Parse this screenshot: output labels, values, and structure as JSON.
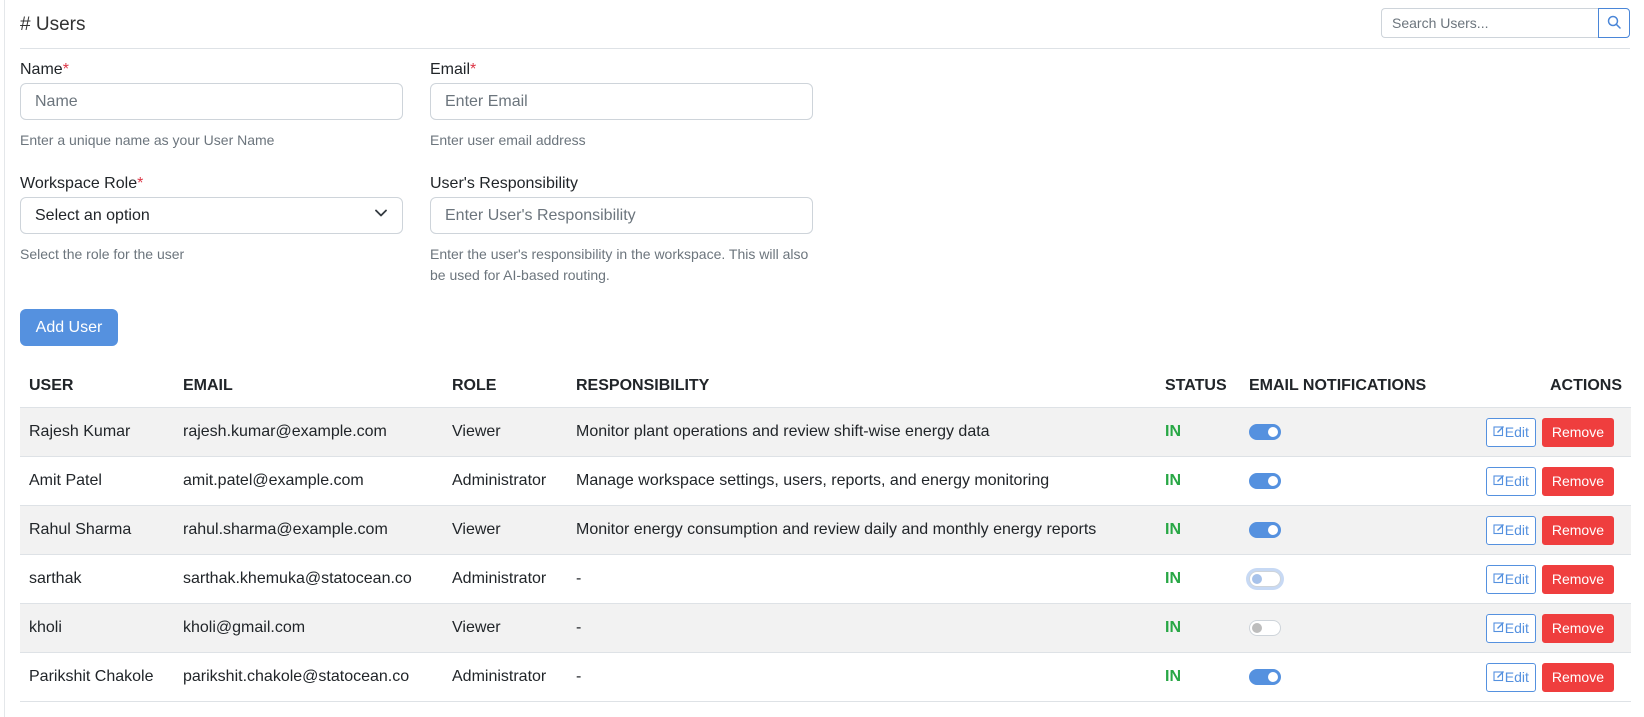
{
  "header": {
    "title": "# Users",
    "search_placeholder": "Search Users..."
  },
  "form": {
    "name": {
      "label": "Name",
      "required_mark": "*",
      "placeholder": "Name",
      "help": "Enter a unique name as your User Name"
    },
    "email": {
      "label": "Email",
      "required_mark": "*",
      "placeholder": "Enter Email",
      "help": "Enter user email address"
    },
    "role": {
      "label": "Workspace Role",
      "required_mark": "*",
      "selected": "Select an option",
      "help": "Select the role for the user"
    },
    "responsibility": {
      "label": "User's Responsibility",
      "placeholder": "Enter User's Responsibility",
      "help": "Enter the user's responsibility in the workspace. This will also be used for AI-based routing."
    },
    "add_button": "Add User"
  },
  "table": {
    "headers": {
      "user": "USER",
      "email": "EMAIL",
      "role": "ROLE",
      "responsibility": "RESPONSIBILITY",
      "status": "STATUS",
      "notifications": "EMAIL NOTIFICATIONS",
      "actions": "ACTIONS"
    },
    "edit_label": "Edit",
    "remove_label": "Remove",
    "rows": [
      {
        "user": "Rajesh Kumar",
        "email": "rajesh.kumar@example.com",
        "role": "Viewer",
        "responsibility": "Monitor plant operations and review shift-wise energy data",
        "status": "IN",
        "notifications": "on"
      },
      {
        "user": "Amit Patel",
        "email": "amit.patel@example.com",
        "role": "Administrator",
        "responsibility": "Manage workspace settings, users, reports, and energy monitoring",
        "status": "IN",
        "notifications": "on"
      },
      {
        "user": "Rahul Sharma",
        "email": "rahul.sharma@example.com",
        "role": "Viewer",
        "responsibility": "Monitor energy consumption and review daily and monthly energy reports",
        "status": "IN",
        "notifications": "on"
      },
      {
        "user": "sarthak",
        "email": "sarthak.khemuka@statocean.co",
        "role": "Administrator",
        "responsibility": "-",
        "status": "IN",
        "notifications": "off-focused"
      },
      {
        "user": "kholi",
        "email": "kholi@gmail.com",
        "role": "Viewer",
        "responsibility": "-",
        "status": "IN",
        "notifications": "off"
      },
      {
        "user": "Parikshit Chakole",
        "email": "parikshit.chakole@statocean.co",
        "role": "Administrator",
        "responsibility": "-",
        "status": "IN",
        "notifications": "on"
      }
    ]
  },
  "colors": {
    "primary": "#5591df",
    "danger": "#ef3e3e",
    "status_in": "#28a745",
    "required": "#dc3545"
  },
  "icons": {
    "search": "search-icon",
    "edit": "edit-icon",
    "dropdown": "chevron-down-icon"
  }
}
